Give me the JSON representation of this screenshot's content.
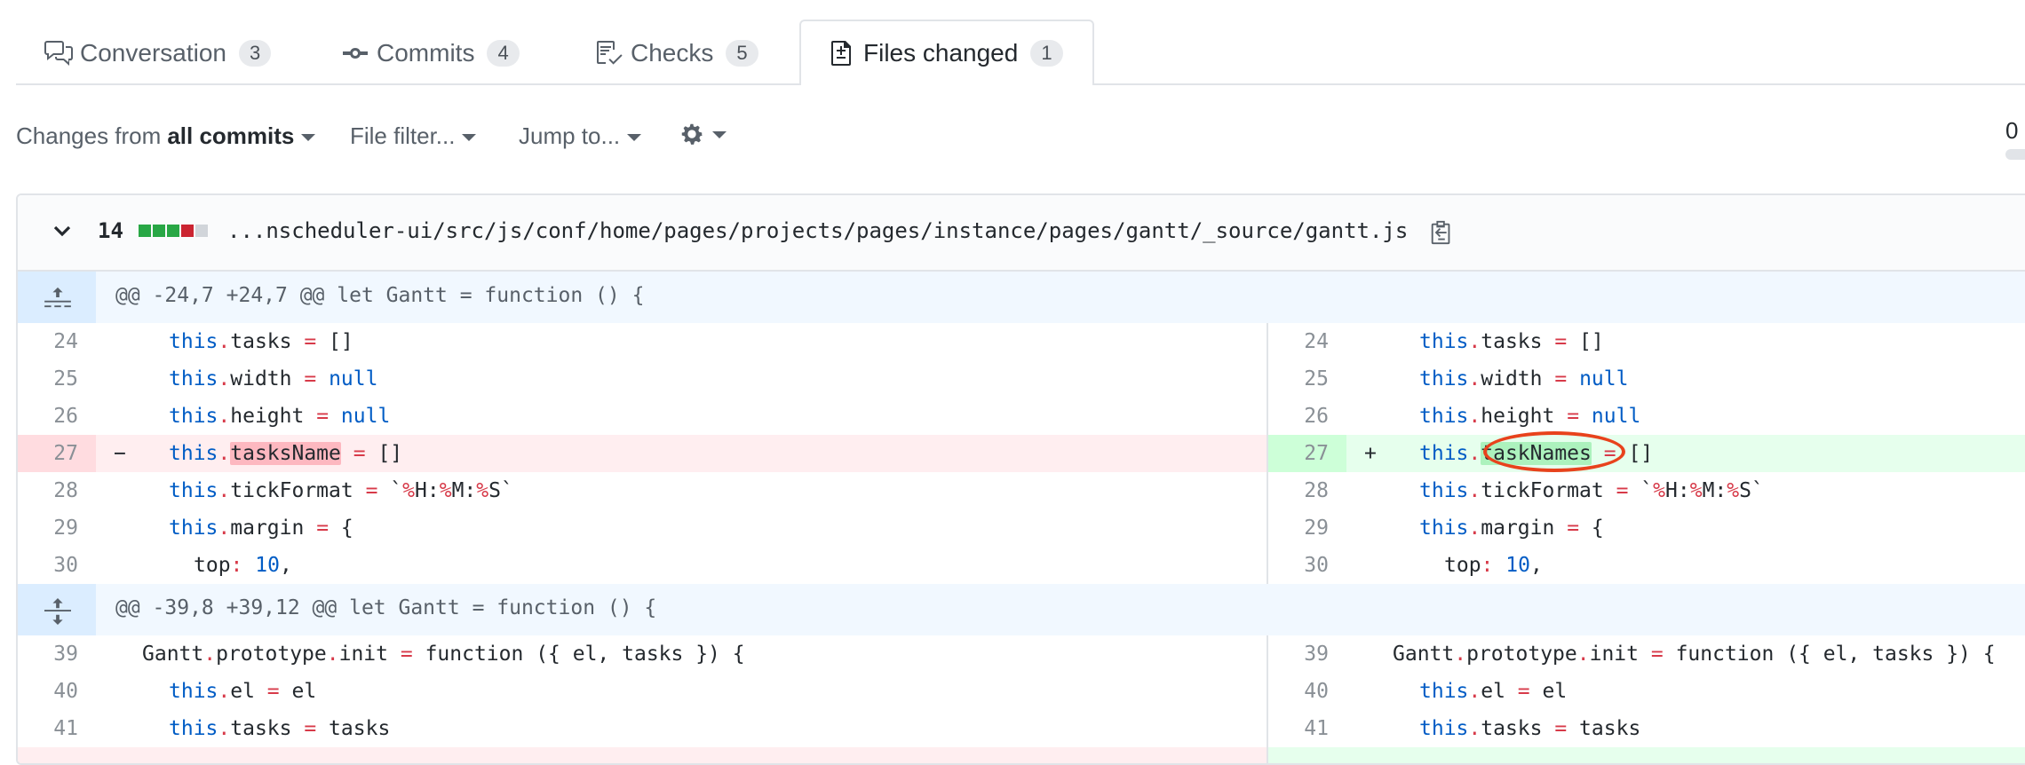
{
  "tabs": [
    {
      "label": "Conversation",
      "count": "3"
    },
    {
      "label": "Commits",
      "count": "4"
    },
    {
      "label": "Checks",
      "count": "5"
    },
    {
      "label": "Files changed",
      "count": "1"
    }
  ],
  "toolbar": {
    "changes_prefix": "Changes from",
    "changes_value": "all commits",
    "file_filter": "File filter...",
    "jump_to": "Jump to...",
    "progress_count": "0"
  },
  "file": {
    "changes_count": "14",
    "path": "...nscheduler-ui/src/js/conf/home/pages/projects/pages/instance/pages/gantt/_source/gantt.js"
  },
  "hunks": [
    {
      "header": "@@ -24,7 +24,7 @@ let Gantt = function () {"
    },
    {
      "header": "@@ -39,8 +39,12 @@ let Gantt = function () {"
    }
  ],
  "lines": {
    "l24": "24",
    "l25": "25",
    "l26": "26",
    "l27": "27",
    "l28": "28",
    "l29": "29",
    "l30": "30",
    "l39": "39",
    "l40": "40",
    "l41": "41"
  },
  "code": {
    "this": "this",
    "dot": ".",
    "eq": "=",
    "tasks": "tasks ",
    "empty_arr": " []",
    "width": "width ",
    "null": "null",
    "height": "height ",
    "tasksName": "tasksName",
    "taskNames": "taskNames",
    "tickFormat": "tickFormat ",
    "tick_open": " `",
    "pct": "%",
    "H": "H:",
    "M": "M:",
    "S": "S",
    "tick_close": "`",
    "margin": "margin ",
    "brace": " {",
    "top": "top",
    "colon": ":",
    "ten": "10",
    "comma": ",",
    "minus": "−",
    "plus": "+",
    "gantt": "Gantt",
    "prototype": "prototype",
    "init": "init ",
    "function": "function",
    "init_args": " ({ el, tasks }) {",
    "el": "el ",
    "el_val": " el",
    "tasks_val": " tasks"
  },
  "colors": {
    "accent": "#0366d6",
    "added": "#28a745",
    "removed": "#cb2431",
    "annotation": "#e8421c"
  }
}
